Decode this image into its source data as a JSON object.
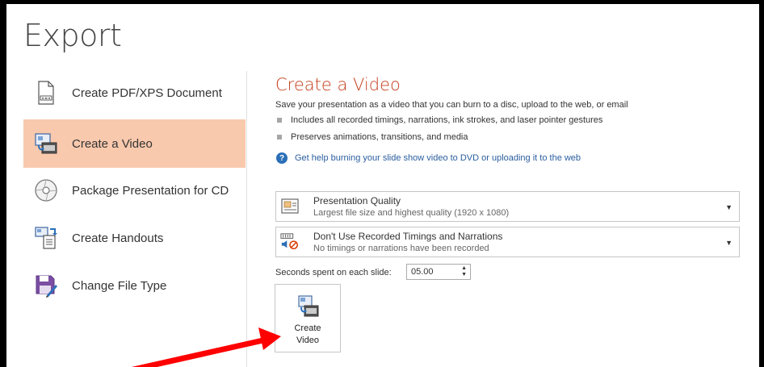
{
  "page": {
    "title": "Export"
  },
  "nav": {
    "items": [
      {
        "label": "Create PDF/XPS Document",
        "icon": "pdf-document-icon",
        "selected": false
      },
      {
        "label": "Create a Video",
        "icon": "video-icon",
        "selected": true
      },
      {
        "label": "Package Presentation for CD",
        "icon": "cd-icon",
        "selected": false
      },
      {
        "label": "Create Handouts",
        "icon": "handouts-icon",
        "selected": false
      },
      {
        "label": "Change File Type",
        "icon": "save-file-icon",
        "selected": false
      }
    ]
  },
  "main": {
    "title": "Create a Video",
    "description": "Save your presentation as a video that you can burn to a disc, upload to the web, or email",
    "bullets": [
      "Includes all recorded timings, narrations, ink strokes, and laser pointer gestures",
      "Preserves animations, transitions, and media"
    ],
    "help_link": "Get help burning your slide show video to DVD or uploading it to the web",
    "quality_dropdown": {
      "title": "Presentation Quality",
      "subtitle": "Largest file size and highest quality (1920 x 1080)"
    },
    "timings_dropdown": {
      "title": "Don't Use Recorded Timings and Narrations",
      "subtitle": "No timings or narrations have been recorded"
    },
    "seconds_label": "Seconds spent on each slide:",
    "seconds_value": "05.00",
    "create_button": {
      "line1": "Create",
      "line2": "Video"
    }
  },
  "colors": {
    "accent": "#c43e1c",
    "selected_bg": "#f9c9ad",
    "link": "#2a5e9e",
    "annotation_arrow": "#ff0000"
  }
}
